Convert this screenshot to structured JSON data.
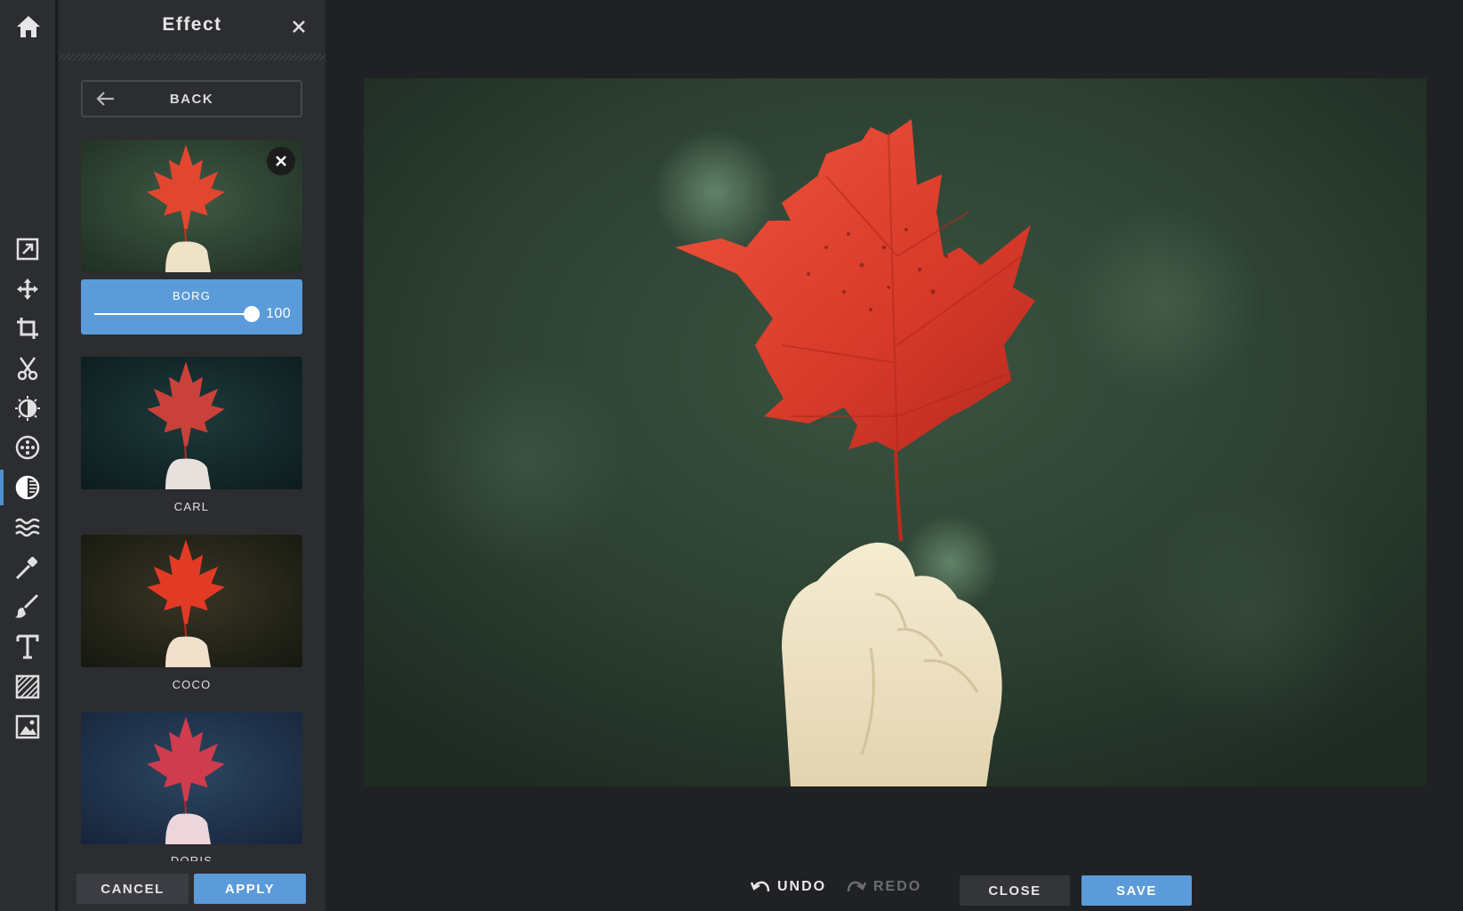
{
  "panel": {
    "title": "Effect",
    "back_label": "BACK"
  },
  "effects": [
    {
      "name": "BORG",
      "selected": true,
      "intensity": "100"
    },
    {
      "name": "CARL"
    },
    {
      "name": "COCO"
    },
    {
      "name": "DORIS"
    }
  ],
  "footer": {
    "cancel_label": "CANCEL",
    "apply_label": "APPLY"
  },
  "bottom_bar": {
    "undo_label": "UNDO",
    "redo_label": "REDO",
    "close_label": "CLOSE",
    "save_label": "SAVE"
  },
  "toolbar": {
    "items": [
      "home-icon",
      "resize-icon",
      "move-icon",
      "crop-icon",
      "cutout-icon",
      "exposure-icon",
      "dots-filter-icon",
      "effect-icon",
      "wave-distort-icon",
      "retouch-icon",
      "draw-icon",
      "text-icon",
      "texture-icon",
      "image-overlay-icon"
    ],
    "active": "effect-icon"
  },
  "colors": {
    "accent": "#5b9bd9",
    "panel_bg": "#2c2d30",
    "app_bg": "#202124",
    "leaf_red": "#d83a2a"
  }
}
